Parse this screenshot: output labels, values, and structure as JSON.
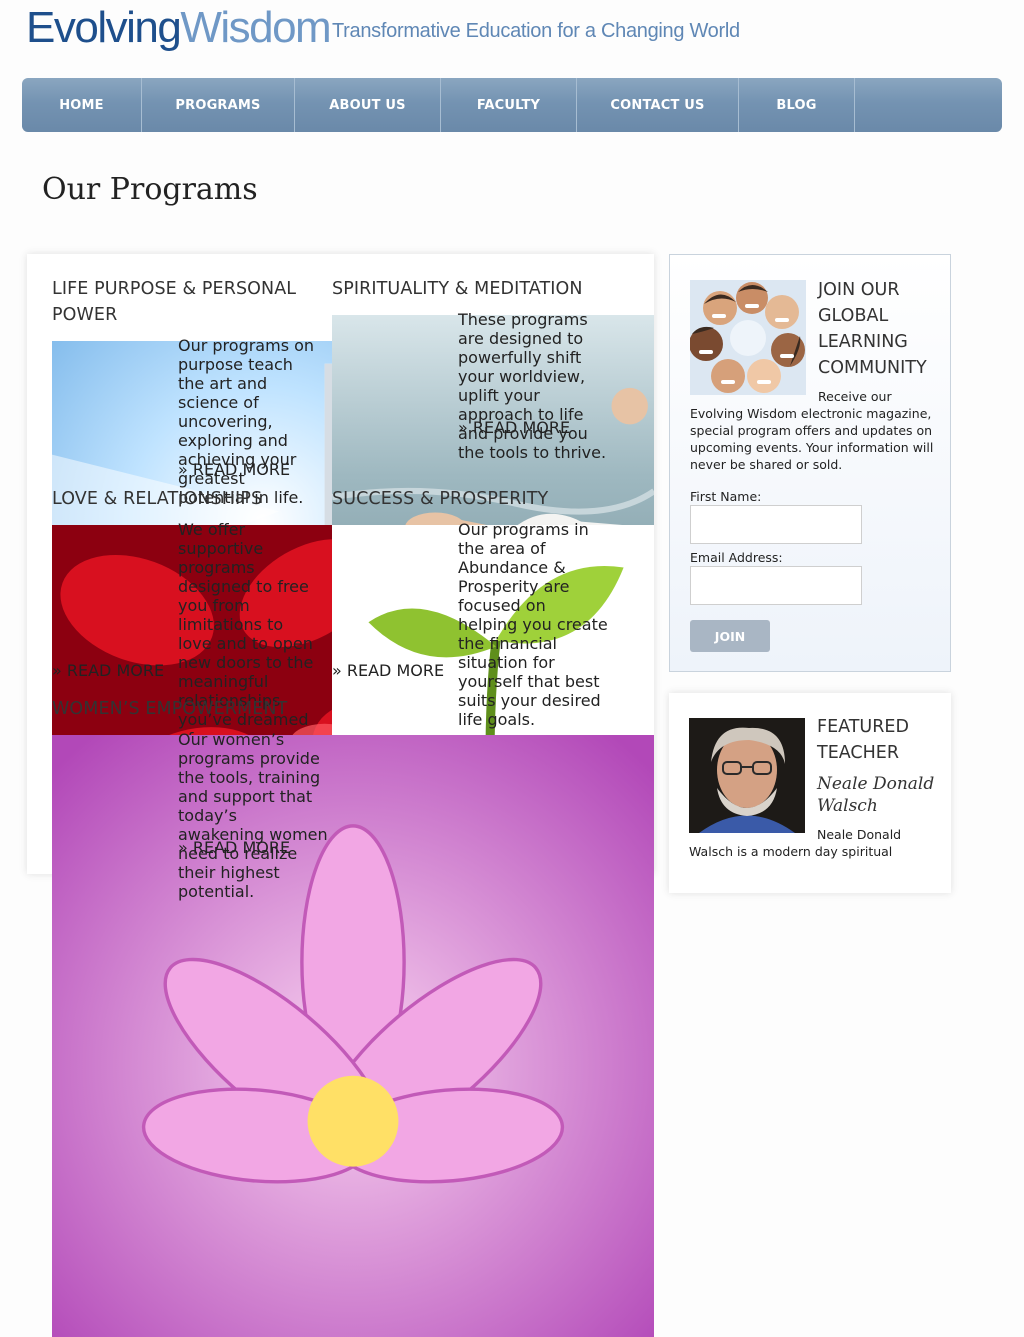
{
  "header": {
    "logo_part1": "Evolving",
    "logo_part2": "Wisdom",
    "tagline": "Transformative Education for a Changing World"
  },
  "nav": {
    "items": [
      "HOME",
      "PROGRAMS",
      "ABOUT US",
      "FACULTY",
      "CONTACT US",
      "BLOG"
    ]
  },
  "page_title": "Our Programs",
  "programs": [
    {
      "title": "LIFE PURPOSE & PERSONAL POWER",
      "description": "Our programs on purpose teach the art and science of uncovering, exploring and achieving your greatest potential in life.",
      "read_more": "» READ MORE"
    },
    {
      "title": "SPIRITUALITY & MEDITATION",
      "description": "These programs are designed to powerfully shift your worldview, uplift your approach to life and provide you the tools to thrive.",
      "read_more": "» READ MORE"
    },
    {
      "title": "LOVE & RELATIONSHIPS",
      "description": "We offer supportive programs designed to free you from limitations to love and to open new doors to the meaningful relationships you’ve dreamed of.",
      "read_more": "» READ MORE"
    },
    {
      "title": "SUCCESS & PROSPERITY",
      "description": "Our programs in the area of Abundance & Prosperity are focused on helping you create the financial situation for yourself that best suits your desired life goals.",
      "read_more": "» READ MORE"
    },
    {
      "title": "WOMEN’S EMPOWERMENT",
      "description": "Our women’s programs provide the tools, training and support that today’s awakening women need to realize their highest potential.",
      "read_more": "» READ MORE"
    }
  ],
  "join": {
    "title": "JOIN OUR GLOBAL LEARNING COMMUNITY",
    "text": "Receive our Evolving Wisdom electronic magazine, special program offers and updates on upcoming events. Your information will never be shared or sold.",
    "first_name_label": "First Name:",
    "email_label": "Email Address:",
    "button": "JOIN"
  },
  "featured": {
    "title": "FEATURED TEACHER",
    "name": "Neale Donald Walsch",
    "text": "Neale Donald Walsch is a modern day spiritual"
  }
}
